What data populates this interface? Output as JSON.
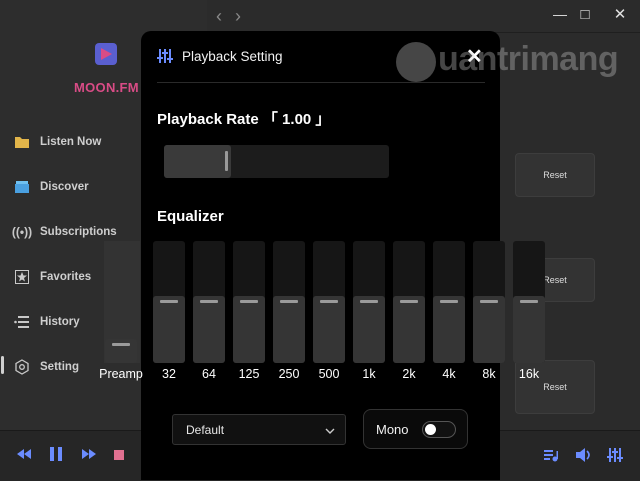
{
  "app": {
    "brand": "MOON.FM",
    "nav": [
      {
        "label": "Listen Now",
        "icon": "folder-icon"
      },
      {
        "label": "Discover",
        "icon": "box-icon"
      },
      {
        "label": "Subscriptions",
        "icon": "broadcast-icon"
      },
      {
        "label": "Favorites",
        "icon": "star-icon"
      },
      {
        "label": "History",
        "icon": "history-icon"
      },
      {
        "label": "Setting",
        "icon": "gear-icon"
      }
    ],
    "reset_buttons": [
      "Reset",
      "Reset",
      "Reset"
    ]
  },
  "dialog": {
    "title": "Playback Setting",
    "close_symbol": "✕",
    "rate_label": "Playback Rate 「 1.00 」",
    "rate_value": 1.0,
    "rate_fill_fraction": 0.3,
    "equalizer_label": "Equalizer",
    "bands": [
      {
        "label": "Preamp",
        "level": 0.2
      },
      {
        "label": "32",
        "level": 0.55
      },
      {
        "label": "64",
        "level": 0.55
      },
      {
        "label": "125",
        "level": 0.55
      },
      {
        "label": "250",
        "level": 0.55
      },
      {
        "label": "500",
        "level": 0.55
      },
      {
        "label": "1k",
        "level": 0.55
      },
      {
        "label": "2k",
        "level": 0.55
      },
      {
        "label": "4k",
        "level": 0.55
      },
      {
        "label": "8k",
        "level": 0.55
      },
      {
        "label": "16k",
        "level": 0.55
      }
    ],
    "preset": "Default",
    "mono_label": "Mono",
    "mono_on": false
  },
  "watermark": "uantrimang",
  "colors": {
    "brand_text": "#e05080",
    "accent_blue": "#6b8cff"
  }
}
